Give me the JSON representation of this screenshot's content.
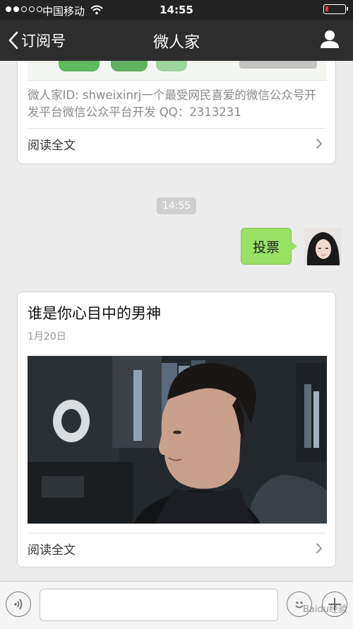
{
  "status": {
    "carrier": "中国移动",
    "time": "14:55"
  },
  "nav": {
    "back_label": "订阅号",
    "title": "微人家"
  },
  "messages": {
    "card_top": {
      "description": "微人家ID: shweixinrj一个最受网民喜爱的微信公众号开发平台微信公众平台开发 QQ：2313231",
      "read_more": "阅读全文"
    },
    "timestamp": "14:55",
    "outgoing": {
      "text": "投票"
    },
    "article": {
      "title": "谁是你心目中的男神",
      "date": "1月20日",
      "read_more": "阅读全文"
    }
  },
  "input": {
    "value": "",
    "watermark": "Baidu经验"
  },
  "colors": {
    "status_bar": "#232323",
    "nav_bar": "#2d2d2d",
    "chat_bg": "#ececec",
    "bubble_green": "#98e165",
    "battery_low": "#e13b3b"
  }
}
